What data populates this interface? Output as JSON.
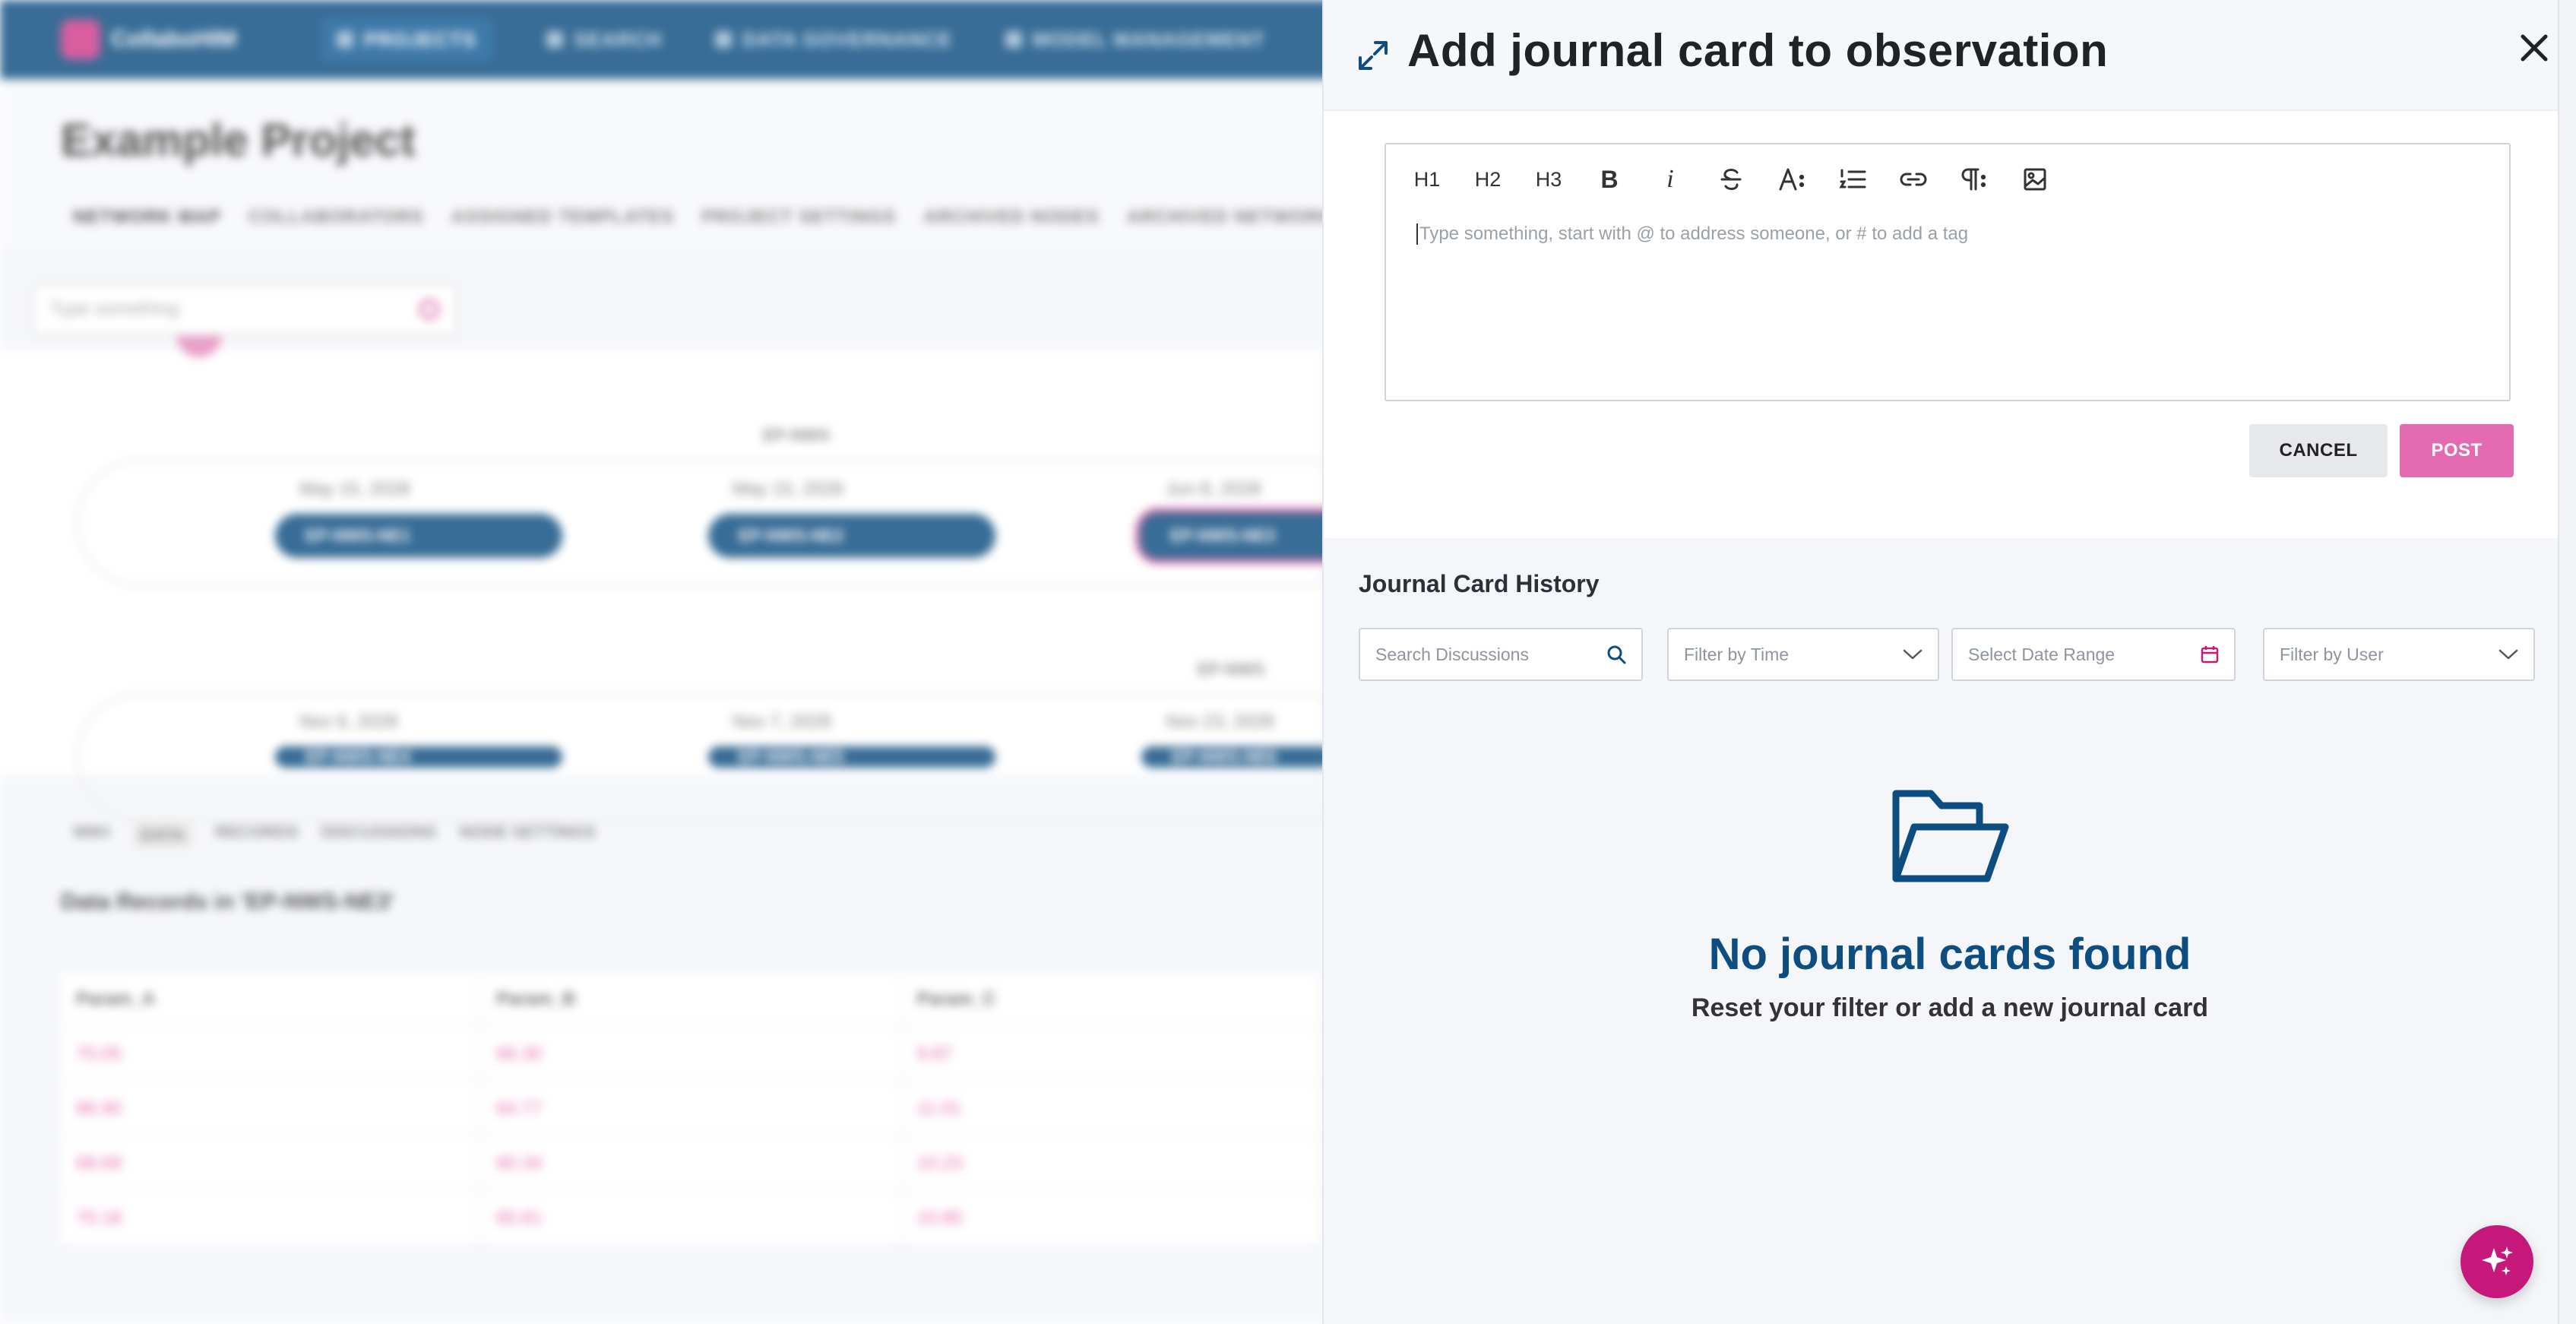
{
  "background": {
    "brand": "CollaboHIM",
    "nav": [
      "PROJECTS",
      "SEARCH",
      "DATA GOVERNANCE",
      "MODEL MANAGEMENT"
    ],
    "project_title": "Example Project",
    "project_tabs": [
      "NETWORK MAP",
      "COLLABORATORS",
      "ASSIGNED TEMPLATES",
      "PROJECT SETTINGS",
      "ARCHIVED NODES",
      "ARCHIVED NETWORK MAPS"
    ],
    "search_placeholder": "Type something",
    "group_labels": [
      "EP-NWS",
      "EP-NWS"
    ],
    "nodes_row1": [
      {
        "date": "May 15, 2028",
        "label": "EP-NWS-NE1"
      },
      {
        "date": "May 15, 2028",
        "label": "EP-NWS-NE2"
      },
      {
        "date": "Jun 8, 2028",
        "label": "EP-NWS-NE3"
      }
    ],
    "nodes_row2": [
      {
        "date": "Nov 6, 2028",
        "label": "EP-NWS-NE4"
      },
      {
        "date": "Nov 7, 2028",
        "label": "EP-NWS-NE5"
      },
      {
        "date": "Nov 23, 2028",
        "label": "EP-NWS-NE6"
      }
    ],
    "sub_tabs": [
      "WIKI",
      "DATA",
      "RECORDS",
      "DISCUSSIONS",
      "NODE SETTINGS"
    ],
    "data_title": "Data Records in 'EP-NWS-NE3'",
    "table_headers": [
      "Param_A",
      "Param_B",
      "Param_C"
    ],
    "table_rows": [
      [
        "70.05",
        "66.30",
        "9.87"
      ],
      [
        "86.90",
        "64.77",
        "11.01"
      ],
      [
        "68.69",
        "60.34",
        "10.23"
      ],
      [
        "70.18",
        "65.61",
        "10.85"
      ]
    ]
  },
  "drawer": {
    "title": "Add journal card to observation",
    "toolbar": {
      "h1": "H1",
      "h2": "H2",
      "h3": "H3",
      "bold": "B",
      "italic": "i"
    },
    "editor_placeholder": "Type something, start with @ to address someone, or # to add a tag",
    "cancel_label": "CANCEL",
    "post_label": "POST",
    "history_title": "Journal Card History",
    "filters": {
      "search_placeholder": "Search Discussions",
      "time_placeholder": "Filter by Time",
      "date_placeholder": "Select Date Range",
      "user_placeholder": "Filter by User"
    },
    "empty_title": "No journal cards found",
    "empty_subtitle": "Reset your filter or add a new journal card"
  },
  "colors": {
    "brand_blue": "#0d4d80",
    "accent_pink": "#e46ab1",
    "fab_magenta": "#c5187a"
  }
}
